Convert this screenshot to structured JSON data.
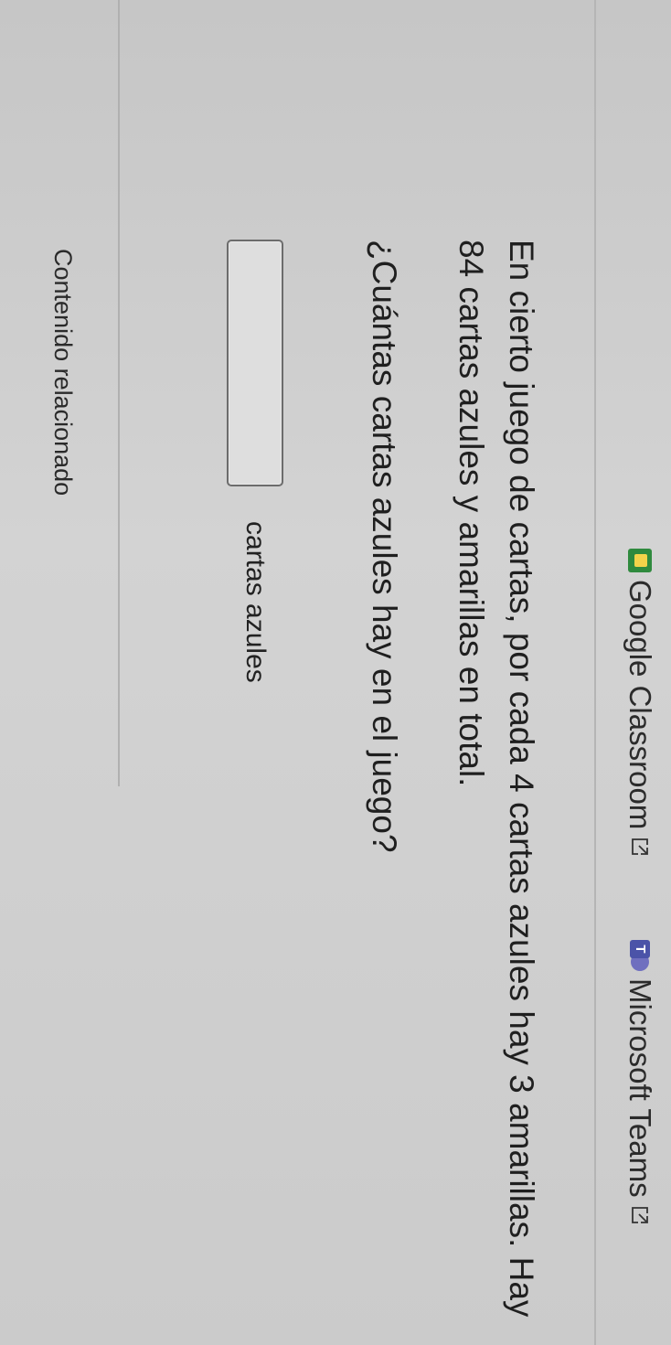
{
  "share_bar": {
    "classroom_label": "Google Classroom",
    "teams_label": "Microsoft Teams"
  },
  "problem": {
    "statement": "En cierto juego de cartas, por cada 4 cartas azules hay 3 amarillas. Hay 84 cartas azules y amarillas en total.",
    "question": "¿Cuántas cartas azules hay en el juego?"
  },
  "answer": {
    "value": "",
    "placeholder": "",
    "unit_label": "cartas azules"
  },
  "related_content": {
    "title": "Contenido relacionado"
  },
  "colors": {
    "classroom_green": "#2f8a3e",
    "teams_purple": "#4b53a8",
    "background": "#cfcfcf"
  },
  "icons": {
    "classroom": "google-classroom-icon",
    "teams": "microsoft-teams-icon",
    "external": "external-link-icon"
  }
}
